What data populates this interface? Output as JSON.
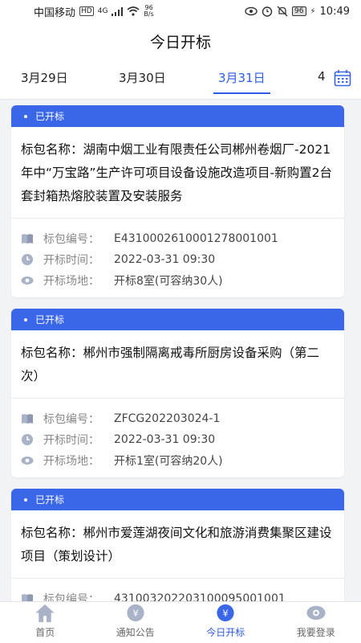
{
  "status": {
    "carrier": "中国移动",
    "hd": "HD",
    "network": "4G",
    "speed_value": "96",
    "speed_unit": "B/s",
    "battery": "96",
    "time": "10:49"
  },
  "header": {
    "title": "今日开标"
  },
  "dates": {
    "tabs": [
      "3月29日",
      "3月30日",
      "3月31日",
      "4"
    ],
    "active_index": 2
  },
  "labels": {
    "name_prefix": "标包名称：",
    "code_label": "标包编号：",
    "time_label": "开标时间：",
    "place_label": "开标场地："
  },
  "cards": [
    {
      "status": "已开标",
      "name": "湖南中烟工业有限责任公司郴州卷烟厂-2021年中“万宝路”生产许可项目设备设施改造项目-新购置2台套封箱热熔胶装置及安装服务",
      "code": "E4310002610001278001001",
      "time": "2022-03-31 09:30",
      "place": "开标8室(可容纳30人)"
    },
    {
      "status": "已开标",
      "name": "郴州市强制隔离戒毒所厨房设备采购（第二次）",
      "code": "ZFCG202203024-1",
      "time": "2022-03-31 09:30",
      "place": "开标1室(可容纳20人)"
    },
    {
      "status": "已开标",
      "name": "郴州市爱莲湖夜间文化和旅游消费集聚区建设项目（策划设计）",
      "code": "431003202203100095001001",
      "time": "",
      "place": ""
    }
  ],
  "tabbar": {
    "items": [
      "首页",
      "通知公告",
      "今日开标",
      "我要登录"
    ],
    "active_index": 2
  },
  "colors": {
    "accent": "#3a66e8",
    "icon_gray": "#a9b2c6"
  }
}
